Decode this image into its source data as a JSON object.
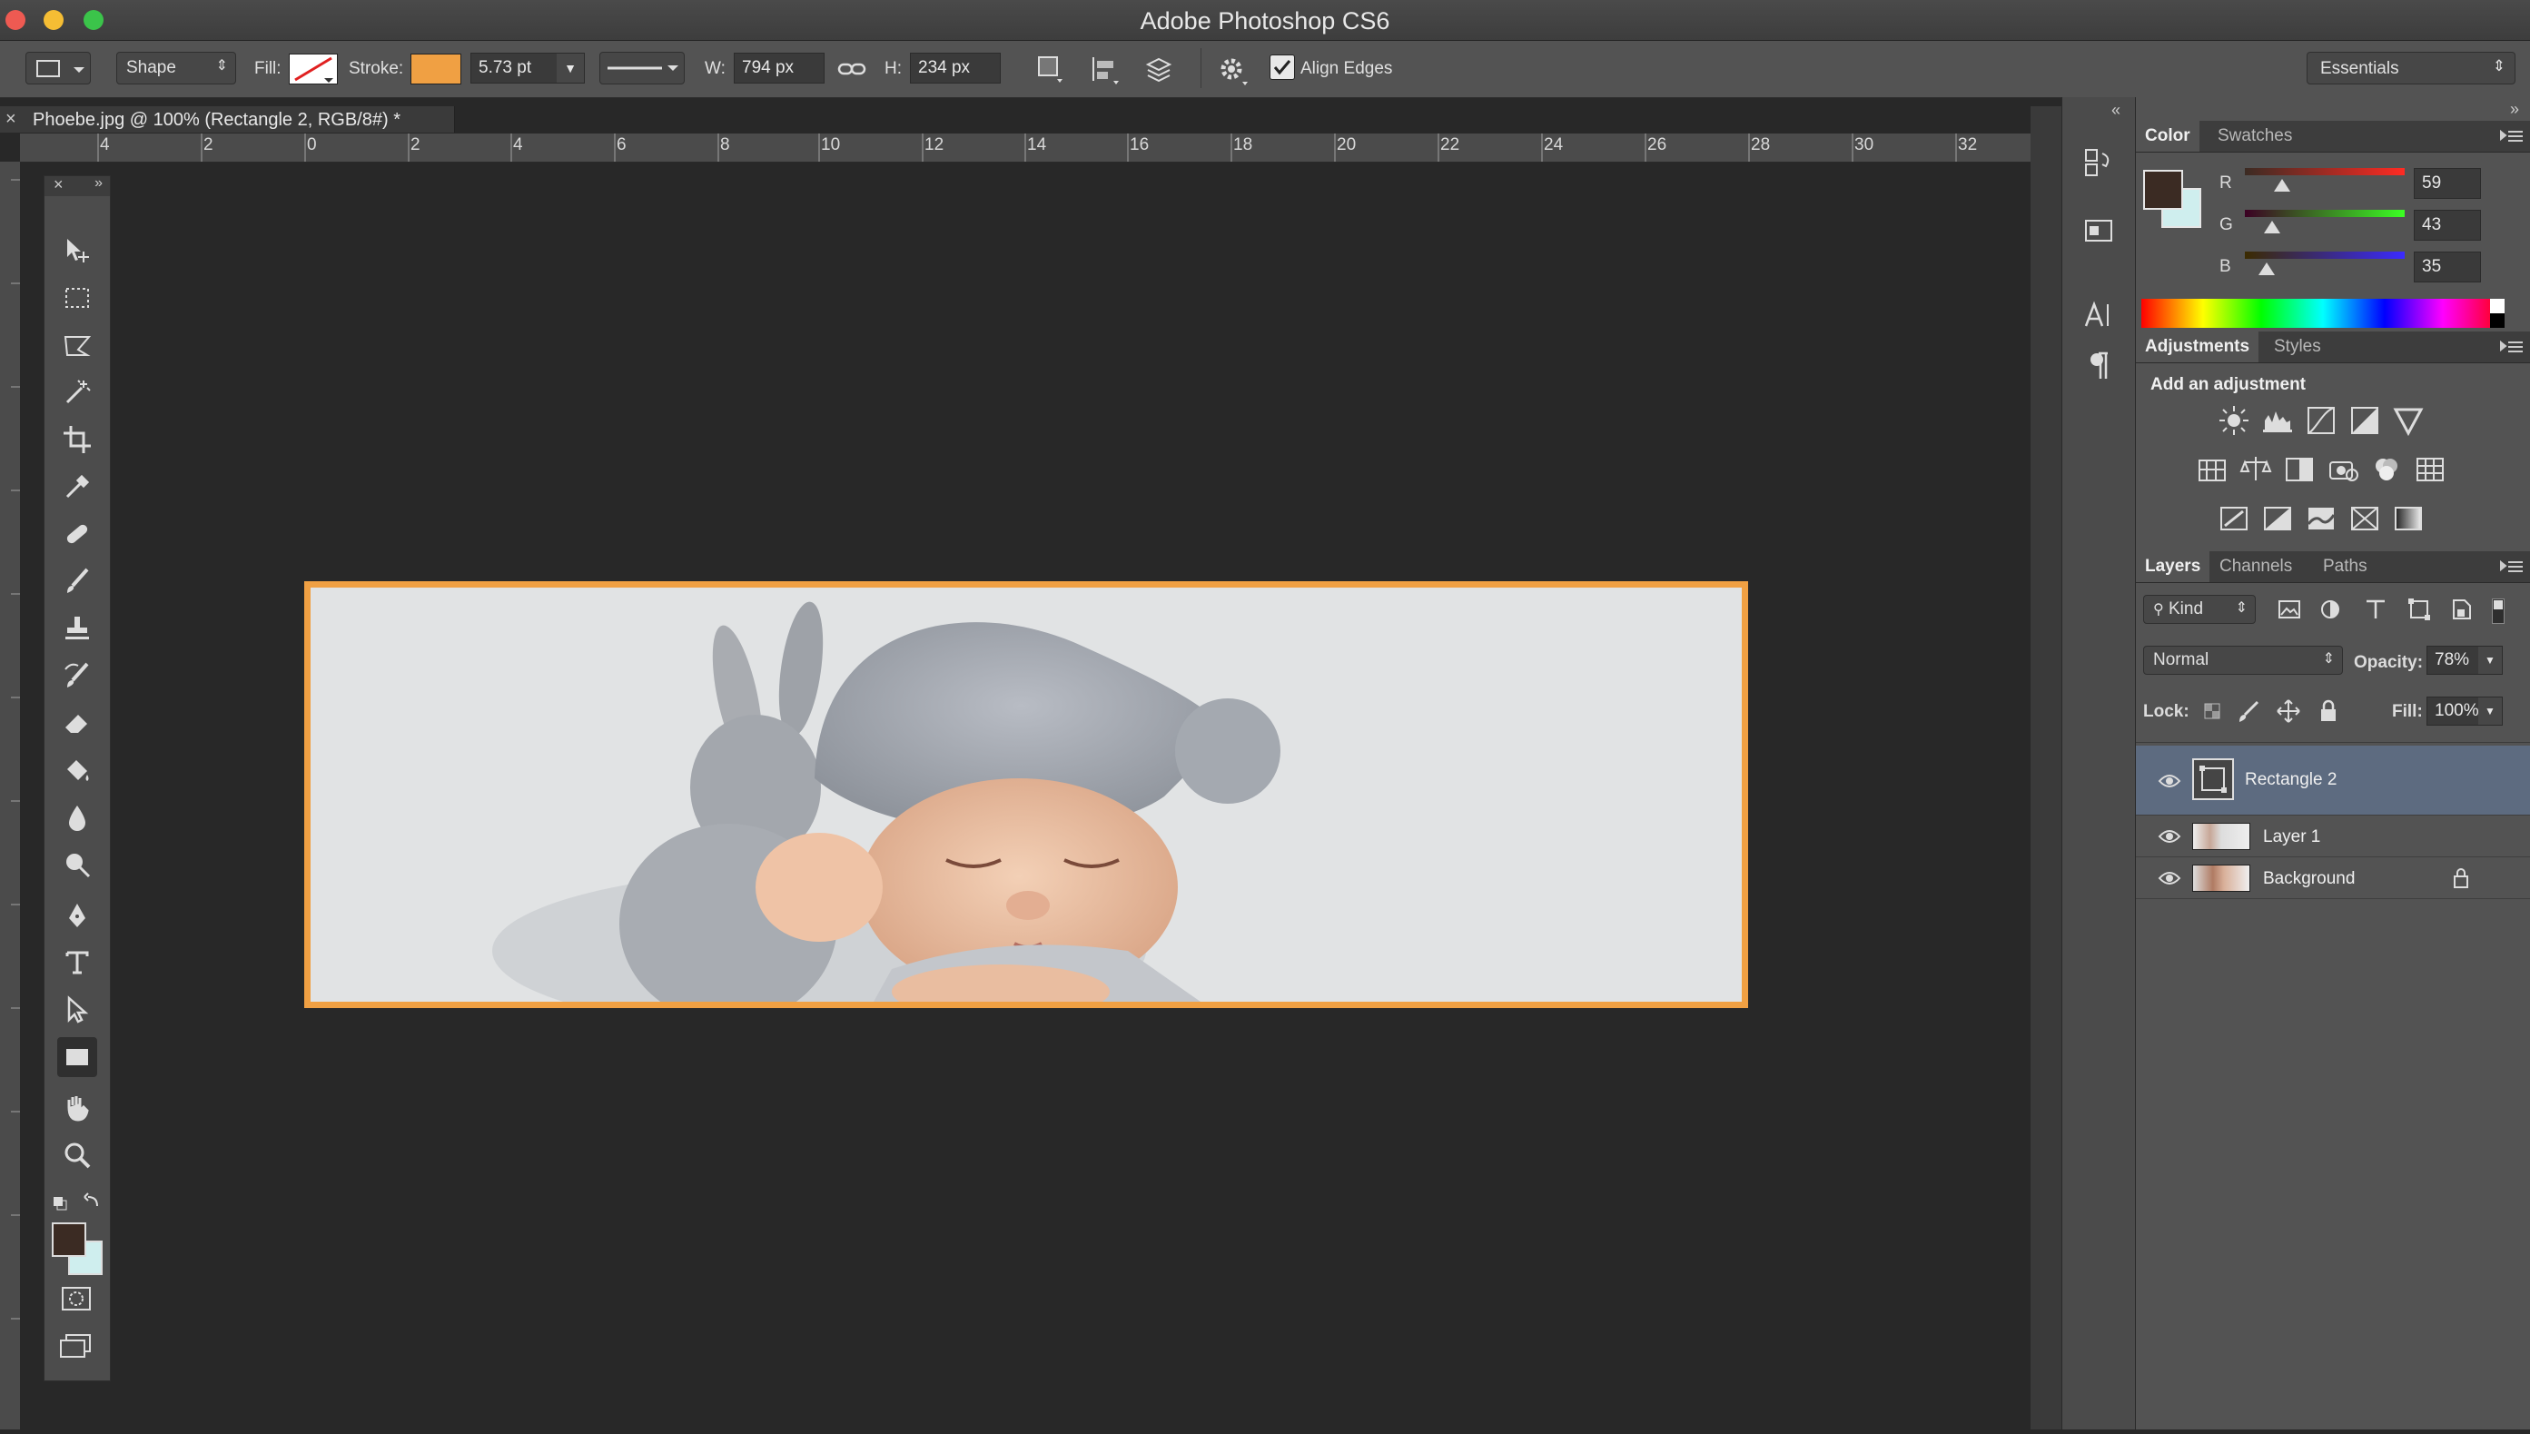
{
  "app": {
    "title": "Adobe Photoshop CS6"
  },
  "options_bar": {
    "tool_mode": "Shape",
    "fill_label": "Fill:",
    "stroke_label": "Stroke:",
    "stroke_color": "#f0a043",
    "stroke_size": "5.73 pt",
    "width_label": "W:",
    "width_value": "794 px",
    "height_label": "H:",
    "height_value": "234 px",
    "align_edges_label": "Align Edges",
    "align_edges_checked": true,
    "workspace": "Essentials"
  },
  "document": {
    "tab_title": "Phoebe.jpg @ 100% (Rectangle 2, RGB/8#) *",
    "ruler_labels": [
      "4",
      "2",
      "0",
      "2",
      "4",
      "6",
      "8",
      "10",
      "12",
      "14",
      "16",
      "18",
      "20",
      "22",
      "24",
      "26",
      "28",
      "30",
      "32"
    ]
  },
  "color_panel": {
    "tabs": [
      "Color",
      "Swatches"
    ],
    "foreground": "#3b2b23",
    "background": "#cfeeee",
    "r_label": "R",
    "g_label": "G",
    "b_label": "B",
    "r_value": "59",
    "g_value": "43",
    "b_value": "35"
  },
  "adjustments_panel": {
    "tabs": [
      "Adjustments",
      "Styles"
    ],
    "heading": "Add an adjustment"
  },
  "layers_panel": {
    "tabs": [
      "Layers",
      "Channels",
      "Paths"
    ],
    "filter_kind": "Kind",
    "blend_mode": "Normal",
    "opacity_label": "Opacity:",
    "opacity_value": "78%",
    "lock_label": "Lock:",
    "fill_label": "Fill:",
    "fill_value": "100%",
    "layers": [
      {
        "name": "Rectangle 2",
        "selected": true
      },
      {
        "name": "Layer 1",
        "selected": false
      },
      {
        "name": "Background",
        "selected": false,
        "locked": true
      }
    ]
  },
  "toolbox_icons": [
    "move-icon",
    "marquee-icon",
    "lasso-icon",
    "magic-wand-icon",
    "crop-icon",
    "eyedropper-icon",
    "healing-brush-icon",
    "brush-icon",
    "clone-stamp-icon",
    "history-brush-icon",
    "eraser-icon",
    "paint-bucket-icon",
    "blur-icon",
    "dodge-icon",
    "pen-icon",
    "type-icon",
    "path-selection-icon",
    "rectangle-icon",
    "hand-icon",
    "zoom-icon"
  ]
}
